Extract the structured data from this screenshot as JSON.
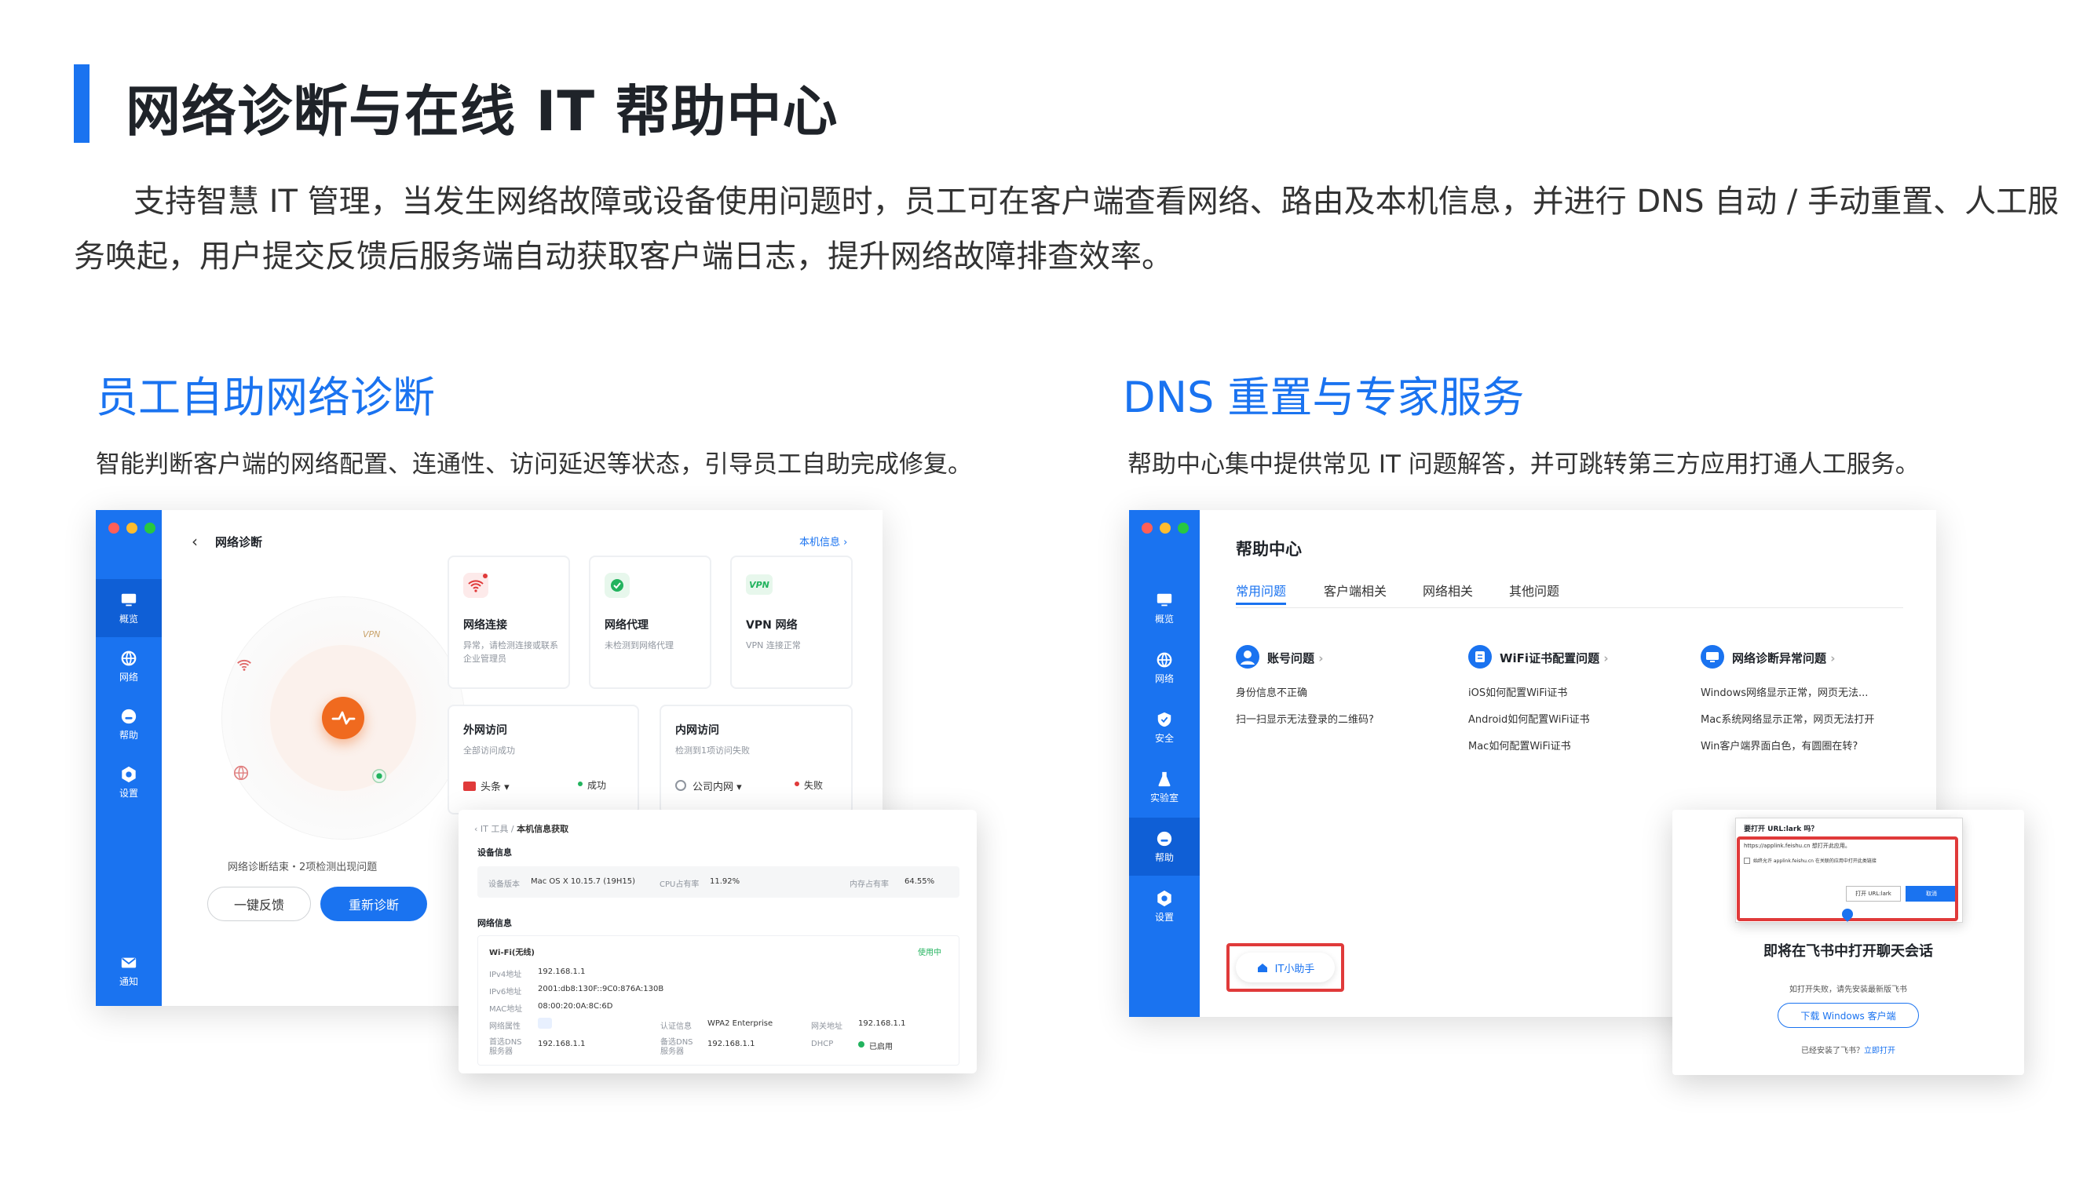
{
  "page": {
    "title": "网络诊断与在线 IT 帮助中心",
    "intro": "支持智慧 IT 管理，当发生网络故障或设备使用问题时，员工可在客户端查看网络、路由及本机信息，并进行 DNS 自动 / 手动重置、人工服务唤起，用户提交反馈后服务端自动获取客户端日志，提升网络故障排查效率。"
  },
  "left_section": {
    "title": "员工自助网络诊断",
    "desc": "智能判断客户端的网络配置、连通性、访问延迟等状态，引导员工自助完成修复。"
  },
  "right_section": {
    "title": "DNS 重置与专家服务",
    "desc": "帮助中心集中提供常见 IT 问题解答，并可跳转第三方应用打通人工服务。"
  },
  "diag_app": {
    "rail": [
      "概览",
      "网络",
      "帮助",
      "设置",
      "通知"
    ],
    "back_title": "网络诊断",
    "host_info_link": "本机信息",
    "vpn_orbit_label": "VPN",
    "status_text": "网络诊断结束・2项检测出现问题",
    "feedback_btn": "一键反馈",
    "rediagnose_btn": "重新诊断",
    "cards": [
      {
        "title": "网络连接",
        "desc": "异常，请检测连接或联系企业管理员"
      },
      {
        "title": "网络代理",
        "desc": "未检测到网络代理"
      },
      {
        "title": "VPN 网络",
        "desc": "VPN 连接正常",
        "badge": "VPN"
      }
    ],
    "external": {
      "title": "外网访问",
      "desc": "全部访问成功",
      "target": "头条",
      "result": "成功"
    },
    "internal": {
      "title": "内网访问",
      "desc": "检测到1项访问失败",
      "target": "公司内网",
      "result": "失败"
    }
  },
  "host_info": {
    "crumb_root": "IT 工具",
    "crumb_current": "本机信息获取",
    "device_section": "设备信息",
    "device_row": [
      {
        "label": "设备版本",
        "value": "Mac OS X 10.15.7 (19H15)"
      },
      {
        "label": "CPU占有率",
        "value": "11.92%"
      },
      {
        "label": "内存占有率",
        "value": "64.55%"
      }
    ],
    "network_section": "网络信息",
    "wifi_label": "Wi-Fi(无线)",
    "wifi_status": "使用中",
    "rows": [
      {
        "label": "IPv4地址",
        "value": "192.168.1.1"
      },
      {
        "label": "IPv6地址",
        "value": "2001:db8:130F::9C0:876A:130B"
      },
      {
        "label": "MAC地址",
        "value": "08:00:20:0A:8C:6D"
      }
    ],
    "bottom": [
      {
        "label": "网络属性",
        "value": ""
      },
      {
        "label": "认证信息",
        "value": "WPA2 Enterprise"
      },
      {
        "label": "网关地址",
        "value": "192.168.1.1"
      },
      {
        "label": "首选DNS服务器",
        "value": "192.168.1.1"
      },
      {
        "label": "备选DNS服务器",
        "value": "192.168.1.1"
      },
      {
        "label": "DHCP",
        "value": "已启用"
      }
    ]
  },
  "help_app": {
    "rail": [
      "概览",
      "网络",
      "安全",
      "实验室",
      "帮助",
      "设置"
    ],
    "title": "帮助中心",
    "tabs": [
      "常用问题",
      "客户端相关",
      "网络相关",
      "其他问题"
    ],
    "groups": [
      {
        "title": "账号问题",
        "items": [
          "身份信息不正确",
          "扫一扫显示无法登录的二维码?"
        ]
      },
      {
        "title": "WiFi证书配置问题",
        "items": [
          "iOS如何配置WiFi证书",
          "Android如何配置WiFi证书",
          "Mac如何配置WiFi证书"
        ]
      },
      {
        "title": "网络诊断异常问题",
        "items": [
          "Windows网络显示正常，网页无法...",
          "Mac系统网络显示正常，网页无法打开",
          "Win客户端界面白色，有圆圈在转?"
        ]
      }
    ],
    "assistant": "IT小助手"
  },
  "feishu_popup": {
    "dialog_title": "要打开 URL:lark 吗？",
    "dialog_url": "https://applink.feishu.cn 想打开此应用。",
    "dialog_check": "始终允许 applink.feishu.cn 在关联的应用中打开此类链接",
    "dialog_open": "打开 URL:lark",
    "dialog_cancel": "取消",
    "headline": "即将在飞书中打开聊天会话",
    "hint": "如打开失败，请先安装最新版飞书",
    "download_btn": "下载 Windows 客户端",
    "installed_prefix": "已经安装了飞书？",
    "installed_link": "立即打开"
  },
  "colors": {
    "brand": "#1a73f0",
    "alert": "#e03a3a",
    "ok": "#22b35e",
    "orange": "#f06a1f"
  }
}
